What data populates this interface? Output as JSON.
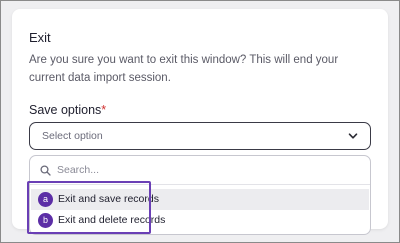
{
  "dialog": {
    "title": "Exit",
    "description": "Are you sure you want to exit this window? This will end your current data import session."
  },
  "save_options": {
    "label": "Save options",
    "required_mark": "*",
    "select_placeholder": "Select option",
    "search_placeholder": "Search...",
    "options": [
      {
        "badge": "a",
        "label": "Exit and save records"
      },
      {
        "badge": "b",
        "label": "Exit and delete records"
      }
    ]
  },
  "colors": {
    "accent": "#5c2ea6",
    "highlight_border": "#6a3fb5",
    "required": "#d0302f"
  },
  "icons": {
    "select_toggle": "chevron-down-icon",
    "search": "search-icon"
  }
}
